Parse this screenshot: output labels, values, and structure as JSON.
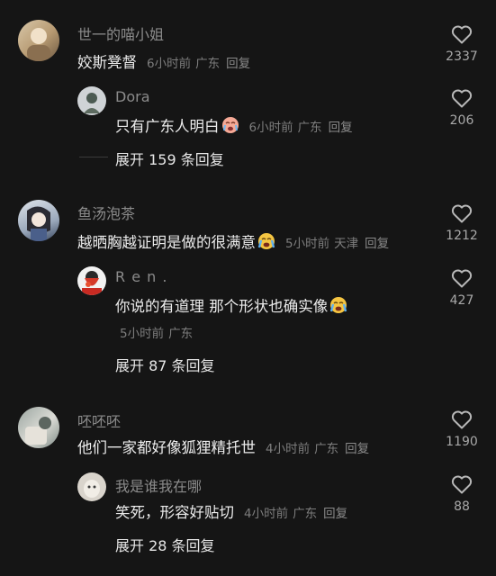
{
  "comments": [
    {
      "name": "世一的喵小姐",
      "text": "姣斯凳督",
      "time": "6小时前",
      "location": "广东",
      "reply": "回复",
      "likes": "2337",
      "replies": [
        {
          "name": "Dora",
          "text": "只有广东人明白",
          "time": "6小时前",
          "location": "广东",
          "reply": "回复",
          "likes": "206"
        }
      ],
      "expand_label": "展开 159 条回复"
    },
    {
      "name": "鱼汤泡茶",
      "text": "越晒胸越证明是做的很满意",
      "time": "5小时前",
      "location": "天津",
      "reply": "回复",
      "likes": "1212",
      "replies": [
        {
          "name": "R e n .",
          "text": "你说的有道理 那个形状也确实像",
          "time": "5小时前",
          "location": "广东",
          "reply": "回复",
          "likes": "427"
        }
      ],
      "expand_label": "展开 87 条回复"
    },
    {
      "name": "呸呸呸",
      "text": "他们一家都好像狐狸精托世",
      "time": "4小时前",
      "location": "广东",
      "reply": "回复",
      "likes": "1190",
      "replies": [
        {
          "name": "我是谁我在哪",
          "text": "笑死，形容好贴切",
          "time": "4小时前",
          "location": "广东",
          "reply": "回复",
          "likes": "88"
        }
      ],
      "expand_label": "展开 28 条回复"
    }
  ],
  "colors": {
    "background": "#151515",
    "name": "#8b8b8b",
    "text": "#ececec",
    "meta": "#7d7d7d"
  },
  "icons": {
    "like": "heart-outline-icon",
    "emoji": "crying-face-emoji-icon"
  }
}
